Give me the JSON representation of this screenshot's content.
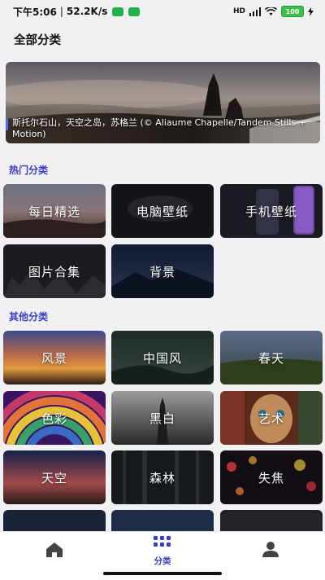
{
  "status_bar": {
    "time": "下午5:06",
    "net_speed": "52.2K/s",
    "signal": "HD",
    "battery": "100"
  },
  "page": {
    "title": "全部分类"
  },
  "banner": {
    "caption": "斯托尔石山，天空之岛，苏格兰 (© Aliaume Chapelle/Tandem Stills + Motion)"
  },
  "sections": {
    "hot": "热门分类",
    "other": "其他分类"
  },
  "hot_categories": [
    {
      "label": "每日精选"
    },
    {
      "label": "电脑壁纸"
    },
    {
      "label": "手机壁纸"
    },
    {
      "label": "图片合集"
    },
    {
      "label": "背景"
    }
  ],
  "other_categories": [
    {
      "label": "风景"
    },
    {
      "label": "中国风"
    },
    {
      "label": "春天"
    },
    {
      "label": "色彩"
    },
    {
      "label": "黑白"
    },
    {
      "label": "艺术"
    },
    {
      "label": "天空"
    },
    {
      "label": "森林"
    },
    {
      "label": "失焦"
    }
  ],
  "bottom_nav": {
    "items": [
      {
        "label": "",
        "icon": "home-icon"
      },
      {
        "label": "分类",
        "icon": "category-grid-icon",
        "active": true
      },
      {
        "label": "",
        "icon": "user-icon"
      }
    ]
  },
  "colors": {
    "accent": "#3a3cc8",
    "background": "#f1f1f4"
  }
}
